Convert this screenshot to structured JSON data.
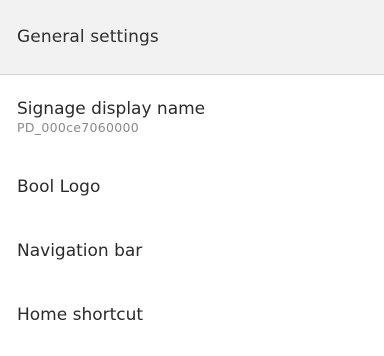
{
  "header": {
    "title": "General settings"
  },
  "items": [
    {
      "title": "Signage display name",
      "subtitle": "PD_000ce7060000"
    },
    {
      "title": "Bool Logo"
    },
    {
      "title": "Navigation bar"
    },
    {
      "title": "Home shortcut"
    }
  ],
  "colors": {
    "header_background": "#f2f2f2",
    "divider": "#d4d4d4",
    "primary_text": "#2a2a2a",
    "secondary_text": "#8a8a8a",
    "background": "#ffffff"
  }
}
